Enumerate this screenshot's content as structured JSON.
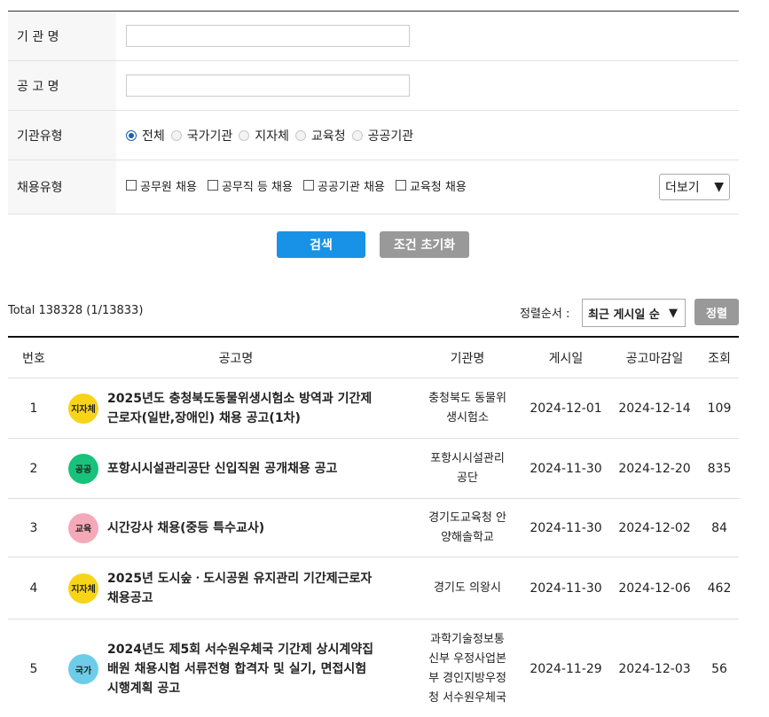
{
  "form": {
    "org_label": "기 관 명",
    "org_value": "",
    "notice_label": "공 고 명",
    "notice_value": "",
    "type_label": "기관유형",
    "types": [
      "전체",
      "국가기관",
      "지자체",
      "교육청",
      "공공기관"
    ],
    "selected_type": "전체",
    "hire_label": "채용유형",
    "hire_types": [
      "공무원 채용",
      "공무직 등 채용",
      "공공기관 채용",
      "교육청 채용"
    ],
    "more_label": "더보기",
    "search_label": "검색",
    "reset_label": "조건 초기화"
  },
  "summary": {
    "total": "Total 138328 (1/13833)",
    "sort_label": "정렬순서 :",
    "sort_value": "최근 게시일 순",
    "sort_button": "정렬"
  },
  "table": {
    "headers": [
      "번호",
      "공고명",
      "기관명",
      "게시일",
      "공고마감일",
      "조회"
    ],
    "rows": [
      {
        "no": "1",
        "badge": "지자체",
        "badge_color": "#f7d417",
        "title": "2025년도 충청북도동물위생시험소 방역과 기간제\n근로자(일반,장애인) 채용 공고(1차)",
        "org": "충청북도 동물위\n생시험소",
        "posted": "2024-12-01",
        "deadline": "2024-12-14",
        "views": "109"
      },
      {
        "no": "2",
        "badge": "공공",
        "badge_color": "#18c27a",
        "title": "포항시시설관리공단 신입직원 공개채용 공고",
        "org": "포항시시설관리\n공단",
        "posted": "2024-11-30",
        "deadline": "2024-12-20",
        "views": "835"
      },
      {
        "no": "3",
        "badge": "교육",
        "badge_color": "#f5a9b8",
        "title": "시간강사 채용(중등 특수교사)",
        "org": "경기도교육청 안\n양해솔학교",
        "posted": "2024-11-30",
        "deadline": "2024-12-02",
        "views": "84"
      },
      {
        "no": "4",
        "badge": "지자체",
        "badge_color": "#f7d417",
        "title": "2025년 도시숲ㆍ도시공원 유지관리 기간제근로자\n채용공고",
        "org": "경기도 의왕시",
        "posted": "2024-11-30",
        "deadline": "2024-12-06",
        "views": "462"
      },
      {
        "no": "5",
        "badge": "국가",
        "badge_color": "#6dcde8",
        "title": "2024년도 제5회 서수원우체국 기간제 상시계약집\n배원 채용시험 서류전형 합격자 및 실기, 면접시험\n시행계획 공고",
        "org": "과학기술정보통\n신부 우정사업본\n부 경인지방우정\n청 서수원우체국",
        "posted": "2024-11-29",
        "deadline": "2024-12-03",
        "views": "56"
      }
    ]
  }
}
